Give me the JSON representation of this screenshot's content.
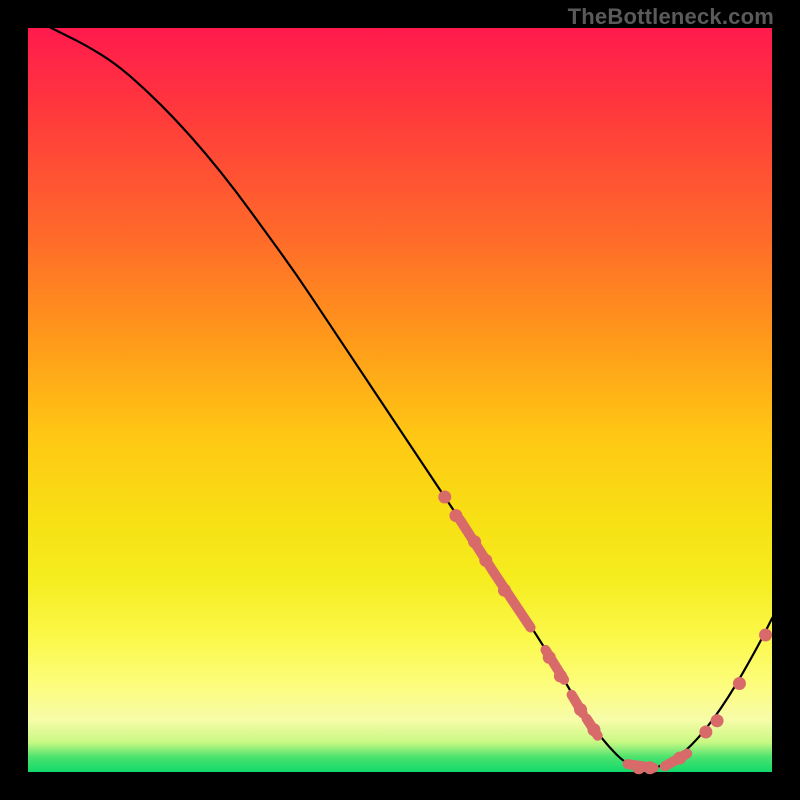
{
  "attribution": "TheBottleneck.com",
  "chart_data": {
    "type": "line",
    "title": "",
    "xlabel": "",
    "ylabel": "",
    "xlim": [
      0,
      100
    ],
    "ylim": [
      0,
      100
    ],
    "series": [
      {
        "name": "bottleneck-curve",
        "x": [
          3,
          5,
          8,
          12,
          16,
          20,
          24,
          28,
          32,
          36,
          40,
          44,
          48,
          52,
          56,
          60,
          64,
          68,
          72,
          74,
          76,
          78,
          80,
          82,
          86,
          90,
          94,
          98,
          100
        ],
        "y": [
          100,
          99,
          97.5,
          95,
          91.5,
          87.5,
          83,
          78,
          72.5,
          67,
          61,
          55,
          49,
          43,
          37,
          31,
          25,
          19,
          12.5,
          9,
          6,
          3.5,
          1.5,
          0.5,
          1,
          4.5,
          10,
          17,
          21
        ]
      }
    ],
    "markers": {
      "dots": [
        {
          "x": 56,
          "y": 37
        },
        {
          "x": 57.5,
          "y": 34.5
        },
        {
          "x": 60,
          "y": 31
        },
        {
          "x": 61.5,
          "y": 28.5
        },
        {
          "x": 64,
          "y": 24.5
        },
        {
          "x": 70,
          "y": 15.5
        },
        {
          "x": 71.5,
          "y": 13
        },
        {
          "x": 74.2,
          "y": 8.5
        },
        {
          "x": 76,
          "y": 5.8
        },
        {
          "x": 82,
          "y": 0.7
        },
        {
          "x": 83.5,
          "y": 0.7
        },
        {
          "x": 87.5,
          "y": 2
        },
        {
          "x": 91,
          "y": 5.5
        },
        {
          "x": 92.5,
          "y": 7
        },
        {
          "x": 95.5,
          "y": 12
        },
        {
          "x": 99,
          "y": 18.5
        }
      ],
      "thick_segments": [
        {
          "x1": 58,
          "y1": 34,
          "x2": 62.5,
          "y2": 27
        },
        {
          "x1": 62.5,
          "y1": 27,
          "x2": 67.5,
          "y2": 19.5
        },
        {
          "x1": 69.5,
          "y1": 16.5,
          "x2": 72,
          "y2": 12.5
        },
        {
          "x1": 73,
          "y1": 10.5,
          "x2": 74.5,
          "y2": 8
        },
        {
          "x1": 75,
          "y1": 7.3,
          "x2": 76.5,
          "y2": 5
        },
        {
          "x1": 80.5,
          "y1": 1.2,
          "x2": 84,
          "y2": 0.7
        },
        {
          "x1": 85.5,
          "y1": 0.9,
          "x2": 88.5,
          "y2": 2.6
        }
      ]
    }
  }
}
